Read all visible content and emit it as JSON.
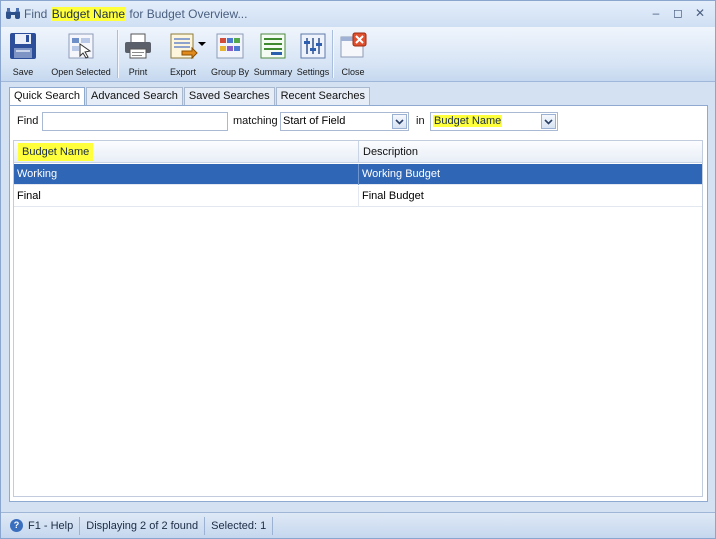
{
  "window": {
    "title_prefix": "Find ",
    "title_highlight": "Budget Name",
    "title_suffix": " for Budget Overview...",
    "controls": [
      "–",
      "◻",
      "✕"
    ],
    "icon": "binoculars-icon"
  },
  "toolbar": {
    "save_label": "Save",
    "open_selected_label": "Open Selected",
    "print_label": "Print",
    "export_label": "Export",
    "group_by_label": "Group By",
    "summary_label": "Summary",
    "settings_label": "Settings",
    "close_label": "Close"
  },
  "tabs": [
    {
      "label": "Quick Search",
      "active": true
    },
    {
      "label": "Advanced Search",
      "active": false
    },
    {
      "label": "Saved Searches",
      "active": false
    },
    {
      "label": "Recent Searches",
      "active": false
    }
  ],
  "search": {
    "find_label": "Find",
    "find_value": "",
    "matching_label": "matching",
    "matching_value": "Start of Field",
    "in_label": "in",
    "in_value": "Budget Name"
  },
  "grid": {
    "columns": [
      "Budget Name",
      "Description"
    ],
    "rows": [
      {
        "name": "Working",
        "description": "Working Budget",
        "selected": true
      },
      {
        "name": "Final",
        "description": "Final Budget",
        "selected": false
      }
    ]
  },
  "status": {
    "help": "F1 - Help",
    "display": "Displaying 2 of 2 found",
    "selected": "Selected: 1"
  },
  "colors": {
    "highlight": "#ffff3c",
    "selection": "#2f66b5",
    "window_bg": "#d3e1f3"
  }
}
